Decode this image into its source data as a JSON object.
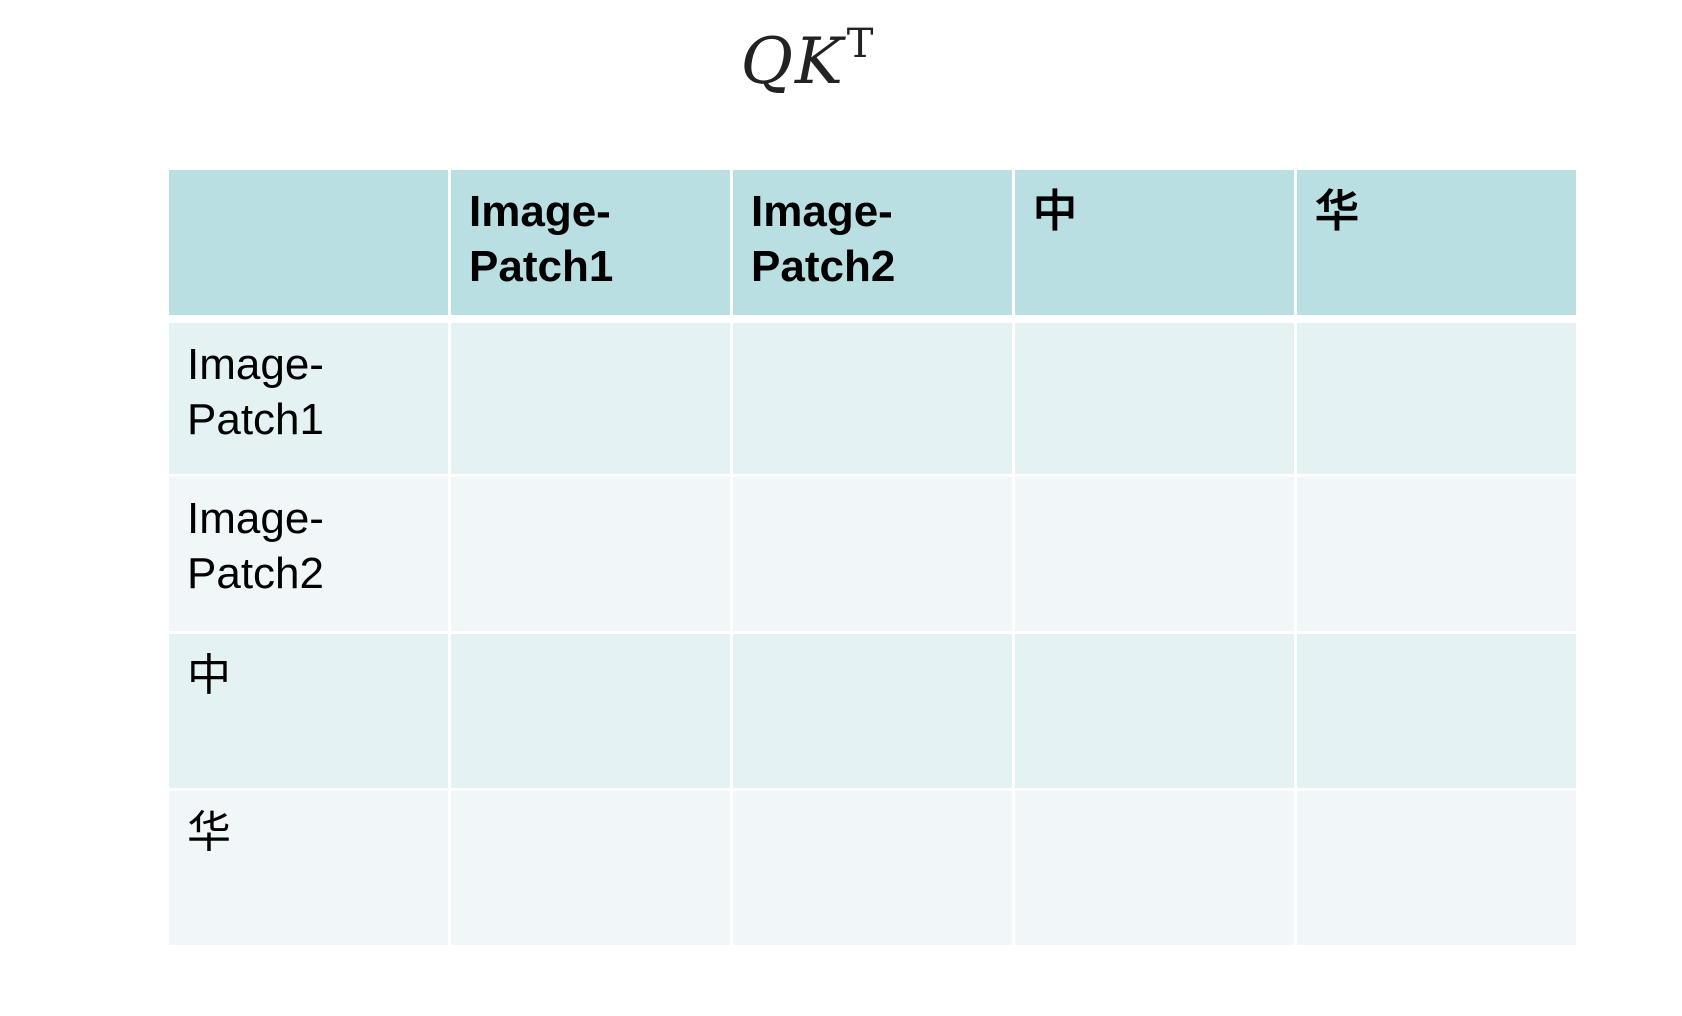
{
  "formula": {
    "base": "QK",
    "superscript": "T"
  },
  "table": {
    "corner": "",
    "column_headers": [
      "Image-\nPatch1",
      "Image-\nPatch2",
      "中",
      "华"
    ],
    "rows": [
      {
        "header": "Image-\nPatch1",
        "cells": [
          "",
          "",
          "",
          ""
        ]
      },
      {
        "header": "Image-\nPatch2",
        "cells": [
          "",
          "",
          "",
          ""
        ]
      },
      {
        "header": "中",
        "cells": [
          "",
          "",
          "",
          ""
        ]
      },
      {
        "header": "华",
        "cells": [
          "",
          "",
          "",
          ""
        ]
      }
    ]
  },
  "colors": {
    "header_bg": "#b9dfe2",
    "row_odd_bg": "#e5f2f3",
    "row_even_bg": "#f1f7f9",
    "grid_line": "#ffffff"
  }
}
